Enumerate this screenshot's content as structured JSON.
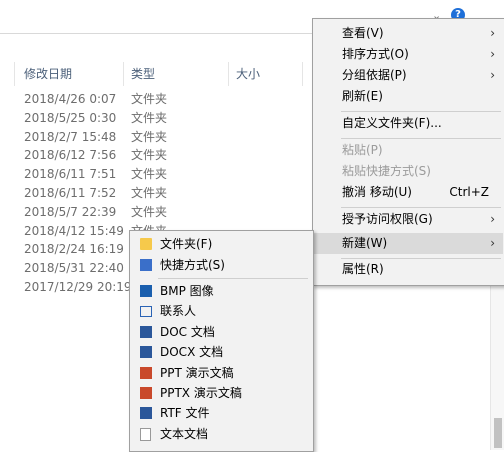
{
  "columns": {
    "date": "修改日期",
    "type": "类型",
    "size": "大小"
  },
  "rows": [
    {
      "date": "2018/4/26 0:07",
      "type": "文件夹"
    },
    {
      "date": "2018/5/25 0:30",
      "type": "文件夹"
    },
    {
      "date": "2018/2/7 15:48",
      "type": "文件夹"
    },
    {
      "date": "2018/6/12 7:56",
      "type": "文件夹"
    },
    {
      "date": "2018/6/11 7:51",
      "type": "文件夹"
    },
    {
      "date": "2018/6/11 7:52",
      "type": "文件夹"
    },
    {
      "date": "2018/5/7 22:39",
      "type": "文件夹"
    },
    {
      "date": "2018/4/12 15:49",
      "type": "文件夹"
    },
    {
      "date": "2018/2/24 16:19",
      "type": ""
    },
    {
      "date": "2018/5/31 22:40",
      "type": ""
    },
    {
      "date": "2017/12/29 20:19",
      "type": ""
    }
  ],
  "context_menu": {
    "view": "查看(V)",
    "sort": "排序方式(O)",
    "group": "分组依据(P)",
    "refresh": "刷新(E)",
    "customize": "自定义文件夹(F)...",
    "paste": "粘贴(P)",
    "paste_shortcut": "粘贴快捷方式(S)",
    "undo_move": "撤消 移动(U)",
    "undo_shortcut": "Ctrl+Z",
    "grant_access": "授予访问权限(G)",
    "new": "新建(W)",
    "properties": "属性(R)"
  },
  "new_submenu": {
    "folder": "文件夹(F)",
    "shortcut": "快捷方式(S)",
    "bmp": "BMP 图像",
    "contact": "联系人",
    "doc": "DOC 文档",
    "docx": "DOCX 文档",
    "ppt": "PPT 演示文稿",
    "pptx": "PPTX 演示文稿",
    "rtf": "RTF 文件",
    "txt": "文本文档"
  }
}
